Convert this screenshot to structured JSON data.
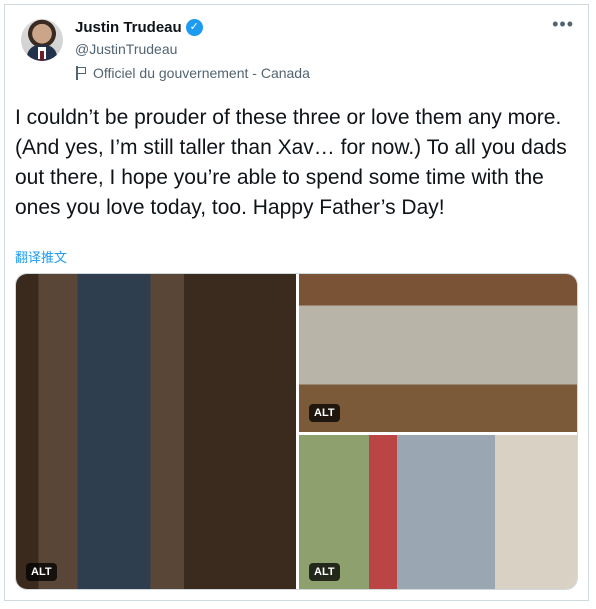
{
  "author": {
    "name": "Justin Trudeau",
    "handle": "@JustinTrudeau",
    "label": "Officiel du gouvernement - Canada",
    "verified_icon": "verified-badge-icon",
    "avatar_icon": "avatar"
  },
  "tweet": {
    "text": "I couldn’t be prouder of these three or love them any more. (And yes, I’m still taller than Xav… for now.) To all you dads out there, I hope you’re able to spend some time with the ones you love today, too. Happy Father’s Day!",
    "translate_label": "翻译推文"
  },
  "media": {
    "alt_badges": [
      "ALT",
      "ALT",
      "ALT"
    ]
  },
  "colors": {
    "accent": "#1d9bf0",
    "secondary_text": "#536471",
    "border": "#cfd9de"
  }
}
